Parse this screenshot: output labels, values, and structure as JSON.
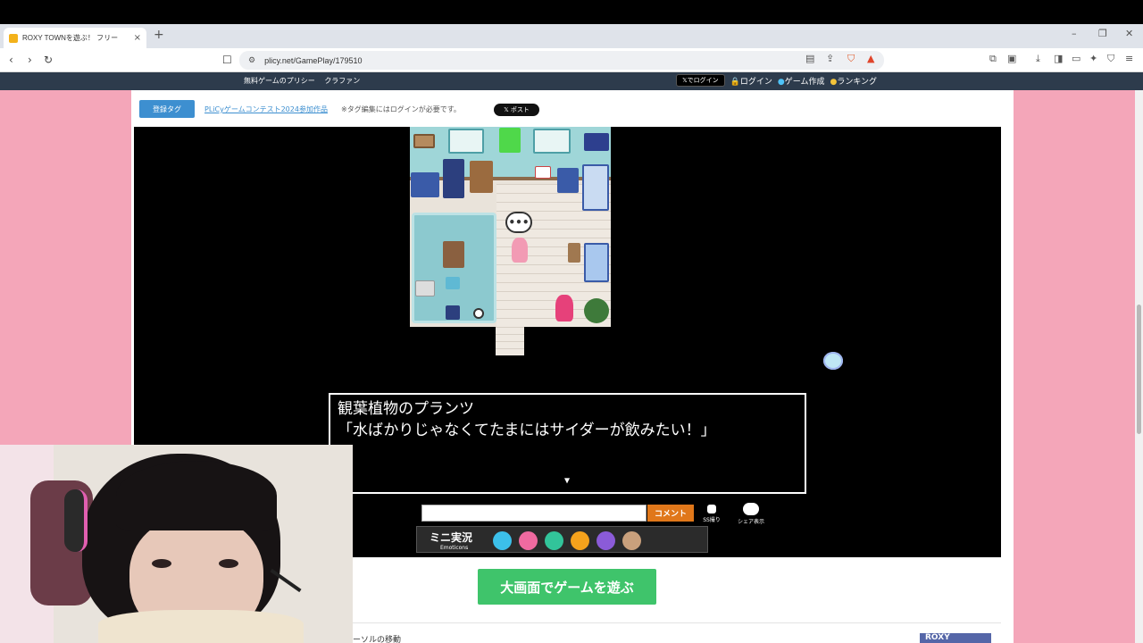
{
  "browser": {
    "tab_title": "ROXY TOWNを遊ぶ！ フリー",
    "tab_close": "×",
    "new_tab": "+",
    "url": "plicy.net/GamePlay/179510",
    "window_controls": [
      "–",
      "❐",
      "✕"
    ]
  },
  "site_header": {
    "left_links": [
      "無料ゲームのプリシー",
      "クラファン"
    ],
    "x_login": "𝕏でログイン",
    "login": "ログイン",
    "make_game": "ゲーム作成",
    "ranking": "ランキング"
  },
  "tags": {
    "button": "登録タグ",
    "link": "PLiCyゲームコンテスト2024参加作品",
    "note": "※タグ編集にはログインが必要です。",
    "x_post": "𝕏 ポスト"
  },
  "game": {
    "speech_bubble": "•••",
    "dialog_line1": "観葉植物のプランツ",
    "dialog_line2": "「水ばかりじゃなくてたまにはサイダーが飲みたい！」",
    "dialog_arrow": "▼"
  },
  "comment": {
    "placeholder": "",
    "button": "コメント",
    "ss_label": "SS撮り",
    "share_label": "シェア表示"
  },
  "emoticons": {
    "label": "ミニ実況",
    "sub": "Emoticons",
    "colors": [
      "#3cc0ea",
      "#f06aa0",
      "#32c49a",
      "#f5a21c",
      "#8b5bd8",
      "#c9a07c"
    ]
  },
  "play_big": "大画面でゲームを遊ぶ",
  "cursor_move": "ーソルの移動",
  "roxy_banner": "ROXY"
}
